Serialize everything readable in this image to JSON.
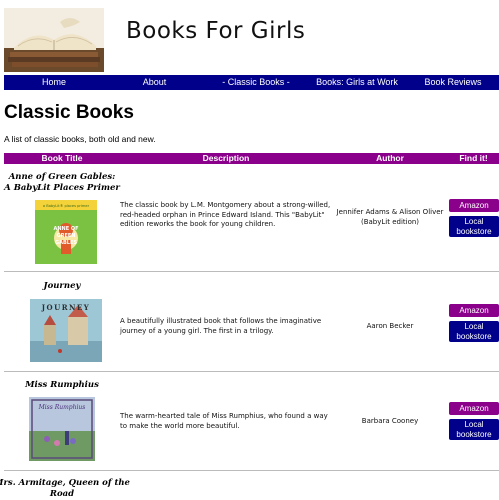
{
  "site": {
    "title": "Books For Girls",
    "logo_icon": "open-book-stack-photo"
  },
  "nav": [
    "Home",
    "About",
    "- Classic Books -",
    "Books: Girls at Work",
    "Book Reviews"
  ],
  "page": {
    "title": "Classic Books",
    "intro": "A list of classic books, both old and new."
  },
  "table": {
    "headers": [
      "Book Title",
      "Description",
      "Author",
      "Find it!"
    ],
    "buttons": {
      "amazon": "Amazon",
      "local": "Local bookstore",
      "local_line1": "Local",
      "local_line2": "bookstore"
    },
    "rows": [
      {
        "title": "Anne of Green Gables: A BabyLit Places Primer",
        "description": "The classic book by L.M. Montgomery about a strong-willed, red-headed orphan in Prince Edward Island. This \"BabyLit\" edition reworks the book for young children.",
        "author": "Jennifer Adams & Alison Oliver (BabyLit edition)",
        "cover_text_top": "a BabyLit® places primer",
        "cover_text": "ANNE OF GREEN GABLES"
      },
      {
        "title": "Journey",
        "description": "A beautifully illustrated book that follows the imaginative journey of a young girl. The first in a trilogy.",
        "author": "Aaron Becker",
        "cover_text": "JOURNEY"
      },
      {
        "title": "Miss Rumphius",
        "description": "The warm-hearted tale of Miss Rumphius, who found a way to make the world more beautiful.",
        "author": "Barbara Cooney",
        "cover_text": "Miss Rumphius"
      },
      {
        "title": "Mrs. Armitage, Queen of the Road"
      }
    ]
  },
  "colors": {
    "nav_bg": "#00008b",
    "header_bg": "#8b008b",
    "amazon_btn": "#8b008b",
    "local_btn": "#00008b"
  }
}
